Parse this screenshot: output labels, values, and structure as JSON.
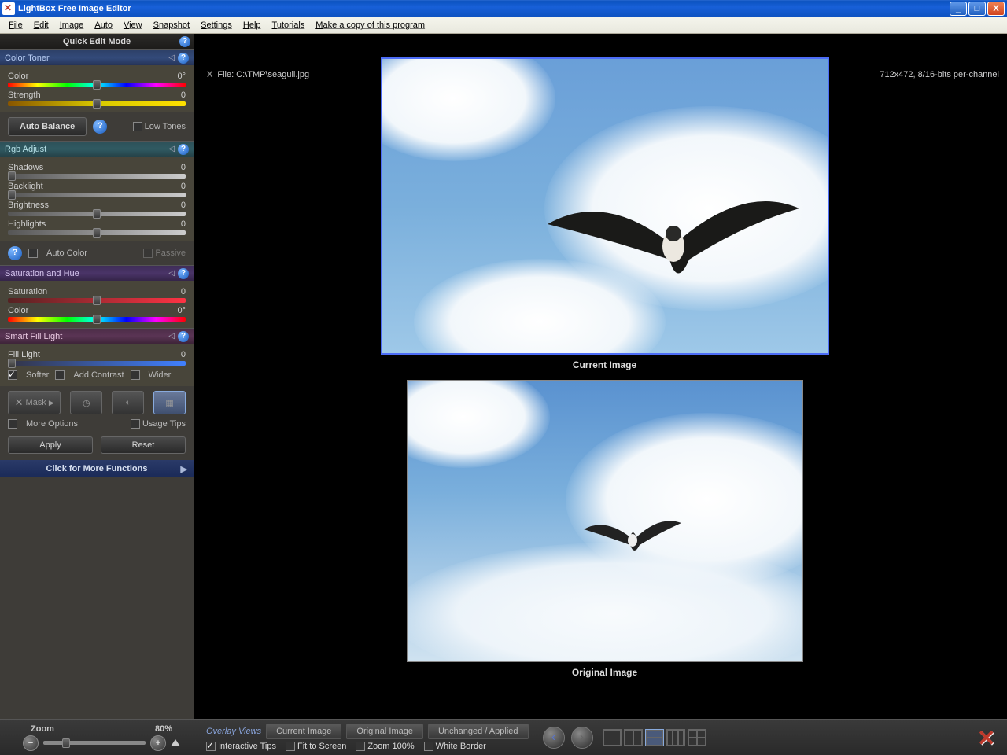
{
  "title": "LightBox Free Image Editor",
  "menu": [
    "File",
    "Edit",
    "Image",
    "Auto",
    "View",
    "Snapshot",
    "Settings",
    "Help",
    "Tutorials",
    "Make a copy of this program"
  ],
  "sidebar_title": "Quick Edit Mode",
  "file_label": "File: C:\\TMP\\seagull.jpg",
  "file_info": "712x472, 8/16-bits per-channel",
  "color_toner": {
    "title": "Color Toner",
    "color_label": "Color",
    "color_val": "0°",
    "strength_label": "Strength",
    "strength_val": "0"
  },
  "auto_balance": "Auto Balance",
  "low_tones": "Low Tones",
  "rgb": {
    "title": "Rgb Adjust",
    "shadows_label": "Shadows",
    "shadows_val": "0",
    "backlight_label": "Backlight",
    "backlight_val": "0",
    "brightness_label": "Brightness",
    "brightness_val": "0",
    "highlights_label": "Highlights",
    "highlights_val": "0"
  },
  "auto_color": "Auto Color",
  "passive": "Passive",
  "sat": {
    "title": "Saturation and Hue",
    "sat_label": "Saturation",
    "sat_val": "0",
    "color_label": "Color",
    "color_val": "0°"
  },
  "fill": {
    "title": "Smart Fill Light",
    "fill_label": "Fill Light",
    "fill_val": "0",
    "softer": "Softer",
    "add_contrast": "Add Contrast",
    "wider": "Wider"
  },
  "mask": "Mask",
  "more_options": "More Options",
  "usage_tips": "Usage Tips",
  "apply": "Apply",
  "reset": "Reset",
  "more_fn": "Click for More Functions",
  "current_caption": "Current Image",
  "original_caption": "Original Image",
  "zoom": {
    "label": "Zoom",
    "pct": "80%"
  },
  "overlay": {
    "label": "Overlay Views",
    "current": "Current Image",
    "original": "Original Image",
    "unchanged": "Unchanged / Applied",
    "tips": "Interactive Tips",
    "fit": "Fit to Screen",
    "z100": "Zoom 100%",
    "border": "White Border"
  }
}
